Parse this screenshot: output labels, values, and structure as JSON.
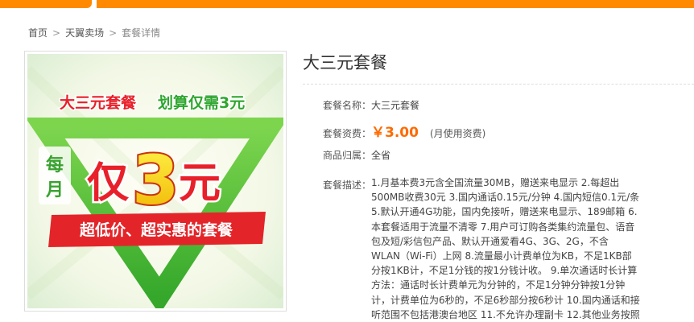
{
  "breadcrumb": {
    "home": "首页",
    "sep": ">",
    "market": "天翼卖场",
    "current": "套餐详情"
  },
  "product_image": {
    "headline": "大三元套餐 划算仅需3元",
    "headline_left": "大三元套餐",
    "headline_right": "划算仅需3元",
    "big_each": "每",
    "big_month": "月",
    "big_only": "仅",
    "big_num": "3",
    "big_unit": "元",
    "banner": "超低价、超实惠的套餐"
  },
  "detail": {
    "title": "大三元套餐",
    "name_label": "套餐名称：",
    "name_value": "大三元套餐",
    "fee_label": "套餐资费：",
    "fee_value": "￥3.00",
    "fee_note": "(月使用资费)",
    "region_label": "商品归属：",
    "region_value": "全省",
    "desc_label": "套餐描述：",
    "desc_lines": [
      "1.月基本费3元含全国流量30MB，赠送来电显示 2.每超出",
      "500MB收费30元 3.国内通话0.15元/分钟 4.国内短信0.1元/条",
      "5.默认开通4G功能，国内免接听，赠送来电显示、189邮箱 6.",
      "本套餐适用于流量不清零 7.用户可订购各类集约流量包、语音",
      "包及短/彩信包产品、默认开通爱看4G、3G、2G，不含",
      "WLAN（Wi-Fi）上网 8.流量最小计费单位为KB，不足1KB部",
      "分按1KB计，不足1分钱的按1分钱计收。 9.单次通话时长计算",
      "方法：通话时长计费单元为分钟的，不足1分钟分钟按1分钟",
      "计，计费单位为6秒的，不足6秒部分按6秒计 10.国内通话和接",
      "听范围不包括港澳台地区 11.不允许办理副卡 12.其他业务按照"
    ]
  },
  "colors": {
    "accent_orange": "#ff8a00",
    "price_orange": "#ff6a00",
    "headline_red": "#e8202a",
    "headline_green": "#2fa62f",
    "triangle_green": "#5cc43c",
    "banner_red": "#e3252a"
  }
}
